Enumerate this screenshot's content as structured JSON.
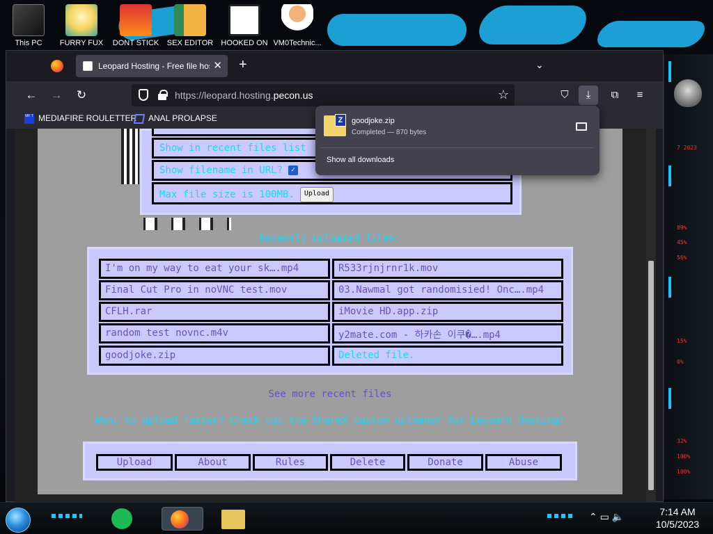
{
  "desktop": {
    "icons": [
      {
        "label": "This PC"
      },
      {
        "label": "FURRY FUX"
      },
      {
        "label": "DONT STICK"
      },
      {
        "label": "SEX EDITOR"
      },
      {
        "label": "HOOKED ON"
      },
      {
        "label": "VM0Technic..."
      }
    ],
    "side_readouts": [
      "7 2023",
      "89%",
      "45%",
      "56%",
      "15%",
      "0%",
      "32%",
      "100%",
      "100%"
    ]
  },
  "browser": {
    "tab": {
      "title": "Leopard Hosting - Free file host",
      "close": "✕"
    },
    "new_tab": "+",
    "tab_list": "⌄",
    "nav": {
      "back": "←",
      "forward": "→",
      "reload": "↻"
    },
    "url": {
      "prefix": "https://leopard.hosting.",
      "domain": "pecon.us"
    },
    "toolbar": {
      "star": "☆",
      "pocket": "⛉",
      "download": "⤓",
      "extensions": "⧉",
      "menu": "≡"
    },
    "bookmarks": [
      {
        "icon": "MF T",
        "label": "MEDIAFIRE ROULETTER"
      },
      {
        "icon": "",
        "label": "ANAL PROLAPSE"
      }
    ]
  },
  "page": {
    "form": {
      "recent_label": "Show in recent files list",
      "filename_label": "Show filename in URL?",
      "filename_checked": "✓",
      "max_size": "Max file size is 100MB.",
      "upload_button": "Upload"
    },
    "recent_title": "Recently uploaded files:",
    "files": [
      {
        "name": "I'm on my way to eat your sk….mp4",
        "deleted": false
      },
      {
        "name": "R533rjnjrnr1k.mov",
        "deleted": false
      },
      {
        "name": "Final Cut Pro in noVNC test.mov",
        "deleted": false
      },
      {
        "name": "03.Nawmal got randomisied! Onc….mp4",
        "deleted": false
      },
      {
        "name": "CFLH.rar",
        "deleted": false
      },
      {
        "name": "iMovie HD.app.zip",
        "deleted": false
      },
      {
        "name": "random test novnc.m4v",
        "deleted": false
      },
      {
        "name": "y2mate.com - 하카손 이쿠�….mp4",
        "deleted": false
      },
      {
        "name": "goodjoke.zip",
        "deleted": false
      },
      {
        "name": "Deleted file.",
        "deleted": true
      }
    ],
    "see_more": "See more recent files",
    "sharex": "Want to upload faster? Check out the ShareX custom uploader for Leopard Hosting!",
    "footer": [
      "Upload",
      "About",
      "Rules",
      "Delete",
      "Donate",
      "Abuse"
    ]
  },
  "downloads": {
    "filename": "goodjoke.zip",
    "status": "Completed — 870 bytes",
    "show_all": "Show all downloads"
  },
  "taskbar": {
    "time": "7:14 AM",
    "date": "10/5/2023"
  }
}
